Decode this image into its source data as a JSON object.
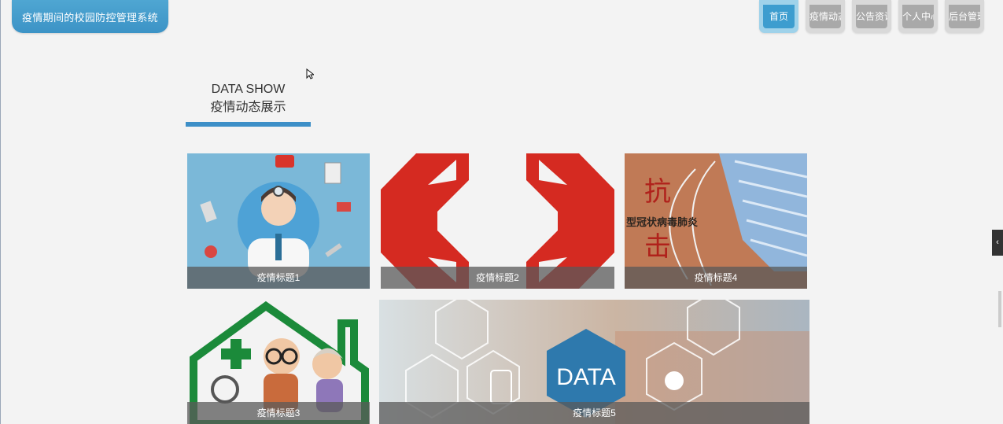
{
  "app": {
    "title": "疫情期间的校园防控管理系统"
  },
  "nav": {
    "items": [
      "首页",
      "疫情动态",
      "公告资讯",
      "个人中心",
      "后台管理"
    ],
    "active": 0
  },
  "section": {
    "en": "DATA SHOW",
    "cn": "疫情动态展示"
  },
  "cards": [
    {
      "caption": "疫情标题1",
      "icon": "doctor-illustration"
    },
    {
      "caption": "疫情标题2",
      "icon": "red-cross-logo"
    },
    {
      "caption": "疫情标题4",
      "icon": "mask-photo",
      "overlay": "抗 击",
      "overlay2": "型冠状病毒肺炎"
    },
    {
      "caption": "疫情标题3",
      "icon": "elderly-care-house"
    },
    {
      "caption": "疫情标题5",
      "icon": "data-hexagon-photo",
      "overlay": "DATA"
    }
  ],
  "colors": {
    "accent": "#3d9dcf",
    "primary_bar": "#3d8fc7"
  }
}
